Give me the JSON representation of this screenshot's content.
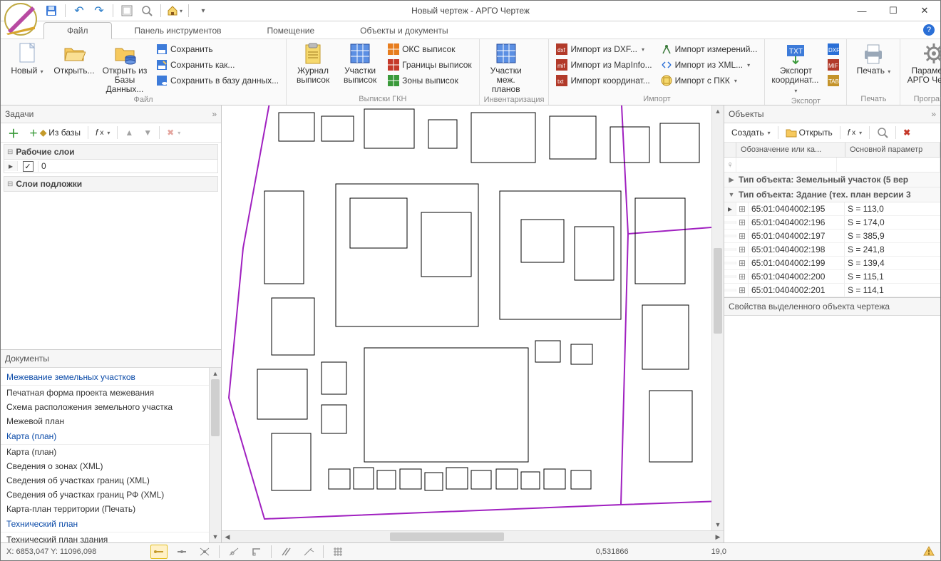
{
  "window": {
    "title": "Новый чертеж - АРГО Чертеж"
  },
  "tabs": {
    "file": "Файл",
    "tools_panel": "Панель инструментов",
    "room": "Помещение",
    "objects_docs": "Объекты и документы"
  },
  "ribbon": {
    "file": {
      "label": "Файл",
      "new": "Новый",
      "open": "Открыть...",
      "open_db": "Открыть из\nБазы Данных...",
      "save": "Сохранить",
      "save_as": "Сохранить как...",
      "save_db": "Сохранить в базу данных..."
    },
    "gkn": {
      "label": "Выписки ГКН",
      "journal": "Журнал\nвыписок",
      "parcels": "Участки\nвыписок",
      "oks": "ОКС выписок",
      "borders": "Границы выписок",
      "zones": "Зоны выписок"
    },
    "inv": {
      "label": "Инвентаризация",
      "mej": "Участки\nмеж. планов"
    },
    "import": {
      "label": "Импорт",
      "dxf": "Импорт из DXF...",
      "mapinfo": "Импорт из MapInfo...",
      "coords": "Импорт координат...",
      "measure": "Импорт измерений...",
      "xml": "Импорт из XML...",
      "pkk": "Импорт с ПКК"
    },
    "export": {
      "label": "Экспорт",
      "coords": "Экспорт\nкоординат..."
    },
    "print": {
      "label": "Печать",
      "print": "Печать"
    },
    "program": {
      "label": "Программа",
      "params": "Параметры\nАРГО Чертеж"
    }
  },
  "left": {
    "tasks_header": "Задачи",
    "from_db": "Из базы",
    "work_layers": "Рабочие слои",
    "layer0": "0",
    "bg_layers": "Слои подложки",
    "docs_header": "Документы",
    "groups": {
      "surveying": "Межевание земельных участков",
      "map": "Карта (план)",
      "tech": "Технический план"
    },
    "items": {
      "print_form": "Печатная форма проекта межевания",
      "scheme": "Схема расположения земельного участка",
      "mej_plan": "Межевой план",
      "map_plan": "Карта (план)",
      "zones_xml": "Сведения о зонах (XML)",
      "borders_xml": "Сведения об участках границ (XML)",
      "borders_rf_xml": "Сведения об участках границ РФ (XML)",
      "map_territory": "Карта-план территории (Печать)",
      "tech_building": "Технический план здания"
    }
  },
  "right": {
    "objects_header": "Объекты",
    "create": "Создать",
    "open": "Открыть",
    "col1": "Обозначение или ка...",
    "col2": "Основной параметр",
    "group1": "Тип объекта: Земельный участок (5 вер",
    "group2": "Тип объекта: Здание (тех. план версии 3",
    "rows": [
      {
        "id": "65:01:0404002:195",
        "p": "S = 113,0"
      },
      {
        "id": "65:01:0404002:196",
        "p": "S = 174,0"
      },
      {
        "id": "65:01:0404002:197",
        "p": "S = 385,9"
      },
      {
        "id": "65:01:0404002:198",
        "p": "S = 241,8"
      },
      {
        "id": "65:01:0404002:199",
        "p": "S = 139,4"
      },
      {
        "id": "65:01:0404002:200",
        "p": "S = 115,1"
      },
      {
        "id": "65:01:0404002:201",
        "p": "S = 114,1"
      }
    ],
    "props_header": "Свойства выделенного объекта чертежа"
  },
  "status": {
    "coords": "X: 6853,047 Y: 11096,098",
    "val1": "0,531866",
    "val2": "19,0"
  }
}
